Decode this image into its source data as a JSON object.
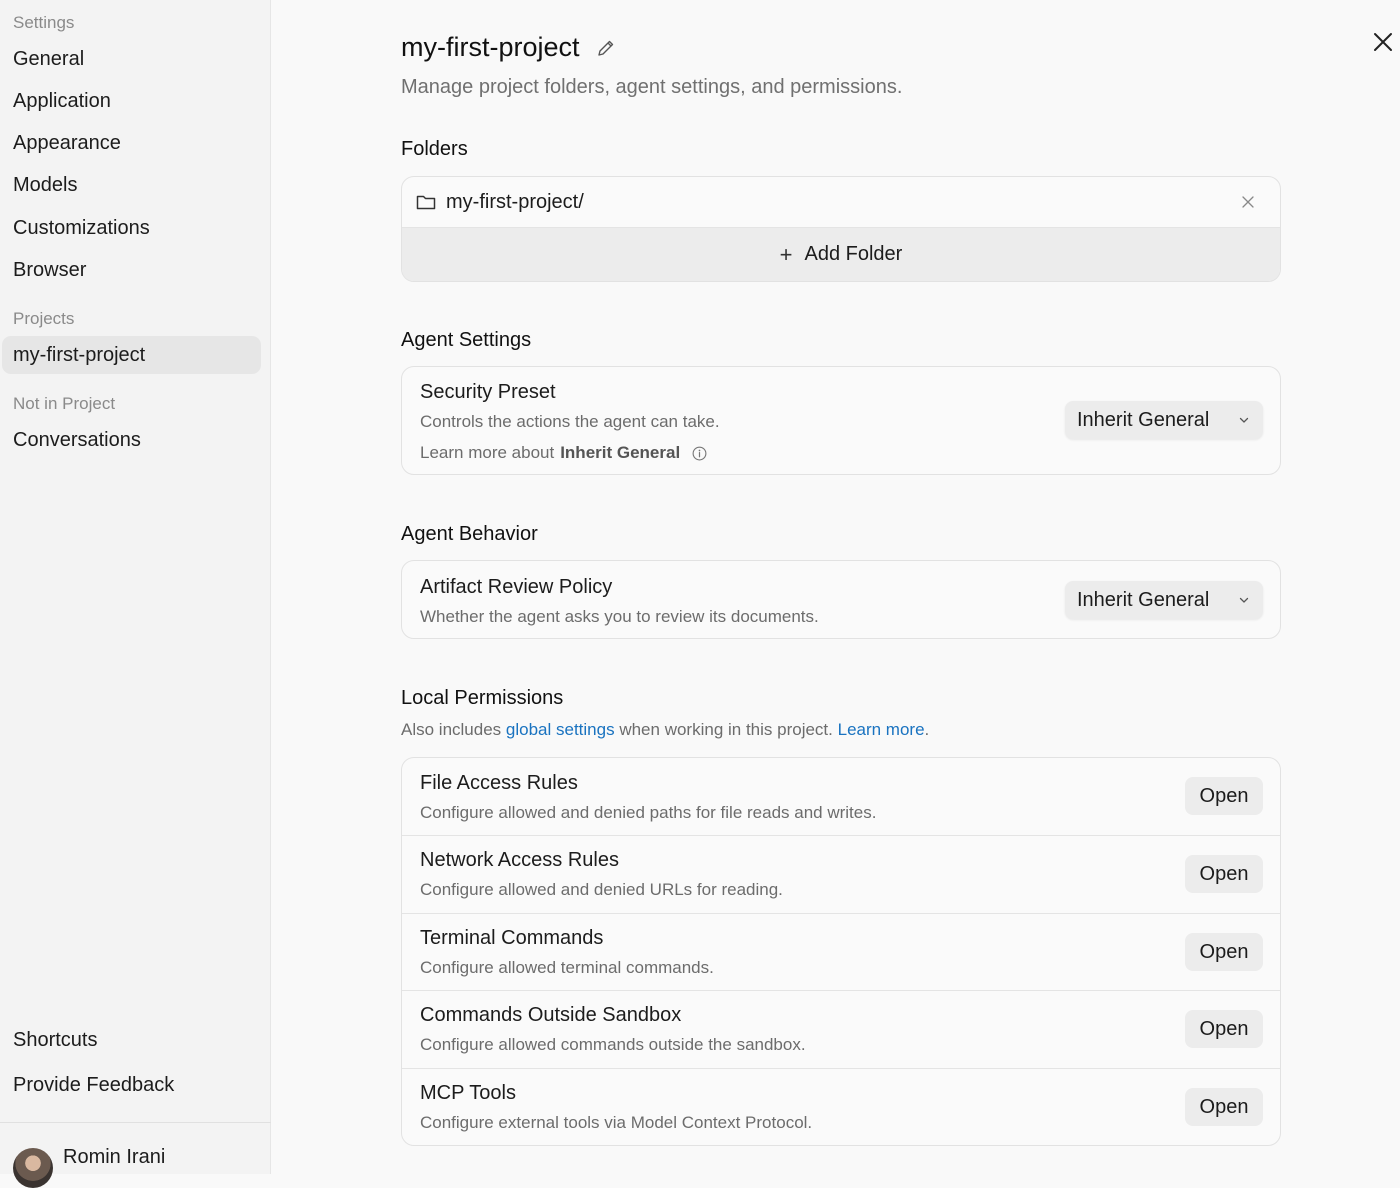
{
  "sidebar": {
    "sections": {
      "settings": "Settings",
      "projects": "Projects",
      "not_in_project": "Not in Project"
    },
    "settings_items": [
      {
        "label": "General"
      },
      {
        "label": "Application"
      },
      {
        "label": "Appearance"
      },
      {
        "label": "Models"
      },
      {
        "label": "Customizations"
      },
      {
        "label": "Browser"
      }
    ],
    "project_items": [
      {
        "label": "my-first-project",
        "active": true
      }
    ],
    "not_in_project_items": [
      {
        "label": "Conversations"
      }
    ],
    "footer_items": [
      {
        "label": "Shortcuts"
      },
      {
        "label": "Provide Feedback"
      }
    ],
    "user": {
      "name": "Romin Irani"
    }
  },
  "header": {
    "title": "my-first-project",
    "subtitle": "Manage project folders, agent settings, and permissions."
  },
  "folders": {
    "heading": "Folders",
    "items": [
      {
        "name": "my-first-project/"
      }
    ],
    "add_label": "Add Folder"
  },
  "agent_settings": {
    "heading": "Agent Settings",
    "security": {
      "title": "Security Preset",
      "desc": "Controls the actions the agent can take.",
      "learn_prefix": "Learn more about",
      "learn_bold": "Inherit General",
      "value": "Inherit General"
    }
  },
  "agent_behavior": {
    "heading": "Agent Behavior",
    "artifact": {
      "title": "Artifact Review Policy",
      "desc": "Whether the agent asks you to review its documents.",
      "value": "Inherit General"
    }
  },
  "local_permissions": {
    "heading": "Local Permissions",
    "desc_prefix": "Also includes",
    "desc_link1": "global settings",
    "desc_middle": "when working in this project.",
    "desc_link2": "Learn more",
    "desc_suffix": ".",
    "rows": [
      {
        "title": "File Access Rules",
        "desc": "Configure allowed and denied paths for file reads and writes.",
        "button": "Open"
      },
      {
        "title": "Network Access Rules",
        "desc": "Configure allowed and denied URLs for reading.",
        "button": "Open"
      },
      {
        "title": "Terminal Commands",
        "desc": "Configure allowed terminal commands.",
        "button": "Open"
      },
      {
        "title": "Commands Outside Sandbox",
        "desc": "Configure allowed commands outside the sandbox.",
        "button": "Open"
      },
      {
        "title": "MCP Tools",
        "desc": "Configure external tools via Model Context Protocol.",
        "button": "Open"
      }
    ]
  },
  "colors": {
    "accent_link": "#1a73c0",
    "sidebar_bg": "#f3f3f3",
    "page_bg": "#f9f9f9"
  },
  "icons": {
    "close": "close-icon",
    "edit": "pencil-icon",
    "folder": "folder-icon",
    "remove": "x-icon",
    "add": "plus-icon",
    "dropdown": "chevron-down-icon",
    "info": "info-icon"
  }
}
